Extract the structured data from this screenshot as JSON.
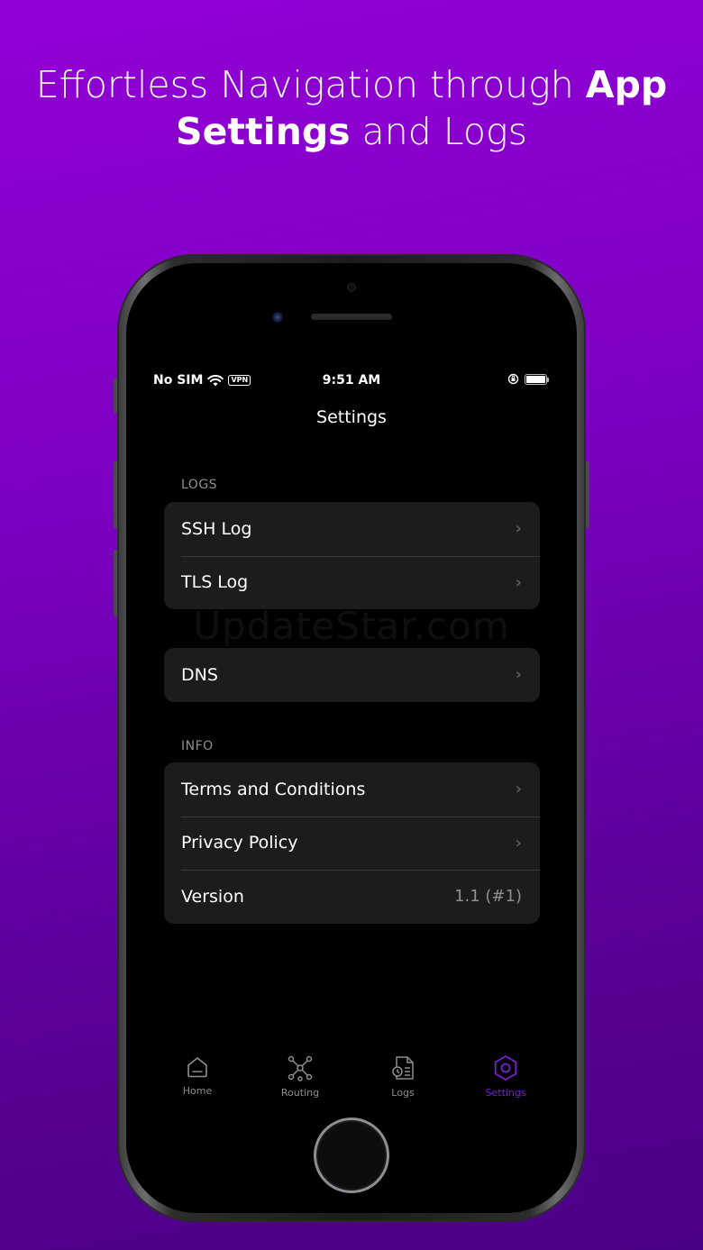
{
  "headline": {
    "part1": "Effortless Navigation through ",
    "bold1": "App",
    "bold2": "Settings",
    "part2": " and Logs"
  },
  "status_bar": {
    "carrier": "No SIM",
    "vpn": "VPN",
    "time": "9:51 AM"
  },
  "nav": {
    "title": "Settings"
  },
  "sections": {
    "logs": {
      "header": "LOGS",
      "items": [
        {
          "label": "SSH Log"
        },
        {
          "label": "TLS Log"
        }
      ]
    },
    "dns": {
      "items": [
        {
          "label": "DNS"
        }
      ]
    },
    "info": {
      "header": "INFO",
      "items": [
        {
          "label": "Terms and Conditions"
        },
        {
          "label": "Privacy Policy"
        },
        {
          "label": "Version",
          "value": "1.1 (#1)"
        }
      ]
    }
  },
  "watermark": "UpdateStar.com",
  "tab_bar": {
    "tabs": [
      {
        "label": "Home",
        "icon": "house-icon",
        "active": false
      },
      {
        "label": "Routing",
        "icon": "network-icon",
        "active": false
      },
      {
        "label": "Logs",
        "icon": "document-clock-icon",
        "active": false
      },
      {
        "label": "Settings",
        "icon": "hexagon-gear-icon",
        "active": true
      }
    ],
    "active_color": "#7a1fd0",
    "inactive_color": "#8e8e93"
  },
  "colors": {
    "background_top": "#9300d6",
    "background_bottom": "#4a0086",
    "row_background": "#1c1c1e"
  }
}
